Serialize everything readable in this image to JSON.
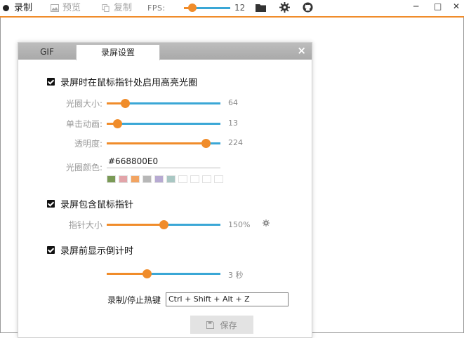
{
  "toolbar": {
    "record_label": "录制",
    "preview_label": "预览",
    "copy_label": "复制",
    "fps_label": "FPS:",
    "fps_value": "12",
    "fps_fraction": 0.18,
    "accent_color": "#f08c2a",
    "track_color": "#3aa7d6"
  },
  "window_controls": {
    "minimize": "─",
    "maximize": "□",
    "close": "✕"
  },
  "dialog": {
    "tabs": [
      {
        "label": "GIF",
        "active": false
      },
      {
        "label": "录屏设置",
        "active": true
      }
    ],
    "close_glyph": "×",
    "highlight": {
      "checkbox_label": "录屏时在鼠标指针处启用高亮光圈",
      "checked": true,
      "size_label": "光圈大小:",
      "size_value": "64",
      "size_fraction": 0.16,
      "click_anim_label": "单击动画:",
      "click_anim_value": "13",
      "click_anim_fraction": 0.09,
      "opacity_label": "透明度:",
      "opacity_value": "224",
      "opacity_fraction": 0.87,
      "color_label": "光圈颜色:",
      "color_value": "#668800E0",
      "swatches": [
        "#7a9a56",
        "#e2a4a9",
        "#f2a462",
        "#b7b7b7",
        "#b7aad2",
        "#a9c7c3",
        "#ffffff",
        "#ffffff",
        "#ffffff",
        "#ffffff"
      ]
    },
    "cursor": {
      "checkbox_label": "录屏包含鼠标指针",
      "checked": true,
      "size_label": "指针大小",
      "size_value": "150%",
      "size_fraction": 0.5
    },
    "countdown": {
      "checkbox_label": "录屏前显示倒计时",
      "checked": true,
      "value": "3 秒",
      "fraction": 0.35
    },
    "hotkey": {
      "label": "录制/停止热键",
      "value": "Ctrl + Shift + Alt + Z"
    },
    "save_label": "保存"
  }
}
